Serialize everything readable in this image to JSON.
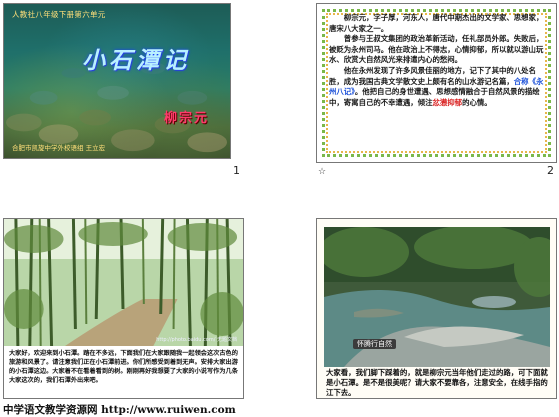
{
  "slides": [
    {
      "number": "1",
      "publisher": "人教社八年级下册第六单元",
      "title": "小石潭记",
      "author": "柳宗元",
      "footer": "合肥市凯旋中学外校语组  王立宏"
    },
    {
      "number": "2",
      "para1": "柳宗元，字子厚，河东人，唐代中期杰出的文学家、思想家，唐宋八大家之一。",
      "para2": "曾参与王叔文集团的政治革新活动，任礼部员外郎。失败后，被贬为永州司马。他在政治上不得志，心情抑郁，所以就以游山玩水、欣赏大自然风光来排遣内心的愁闷。",
      "para3_a": "他在永州发现了许多风景佳丽的地方，记下了其中的八处名胜，成为我国古典文学散文史上颇有名的山水游记名篇，",
      "para3_b": "合称《永州八记》",
      "para3_c": "。他把自己的身世遭遇、思想感情融合于自然风景的描绘中，寄寓自己的不幸遭遇，倾注",
      "para3_d": "忿懑抑郁",
      "para3_e": "的心情。"
    },
    {
      "number": "3",
      "watermark": "http://photo.baidu.com/ 无题文档",
      "caption": "大家好，欢迎来到小石潭。踏在不多远，下面我们在大家跟随我一起领会这次古色的旅游和风景了。请注意我们正在小石潭前进。你们所感受到着到无声。安排大家出游的小石潭这边。大家着不在看着看到的树。刚刚再好我想要了大家的小说写作为几条大家这次的，我们石潭外出来吧。"
    },
    {
      "number": "4",
      "badge": "怀腾行自然",
      "caption": "大家看，我们脚下踩着的，就是柳宗元当年他们走过的路，可下面就是小石潭。是不是很美呢？请大家不要靠各，注意安全，在线手指的江下去。"
    }
  ],
  "credit": "中学语文教学资源网 http://www.ruiwen.com"
}
